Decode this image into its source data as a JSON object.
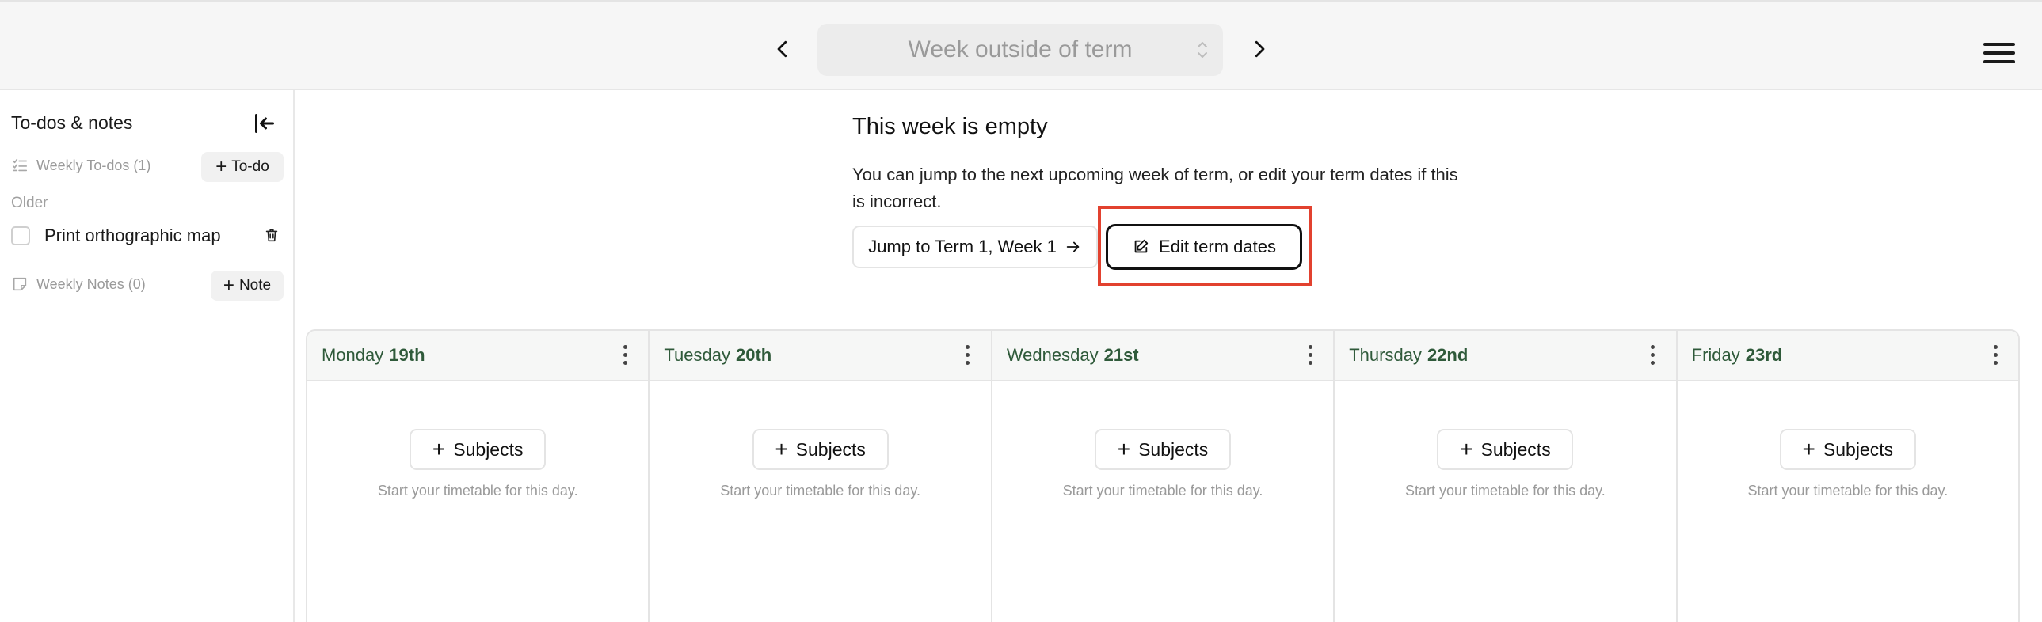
{
  "header": {
    "week_selector": "Week outside of term",
    "prev_icon": "chevron-left-icon",
    "next_icon": "chevron-right-icon",
    "menu_icon": "hamburger-menu-icon"
  },
  "sidebar": {
    "title": "To-dos & notes",
    "todos_label": "Weekly To-dos (1)",
    "add_todo_label": "To-do",
    "older_label": "Older",
    "todo_items": [
      {
        "text": "Print orthographic map",
        "checked": false
      }
    ],
    "notes_label": "Weekly Notes (0)",
    "add_note_label": "Note"
  },
  "notice": {
    "title": "This week is empty",
    "text": "You can jump to the next upcoming week of term, or edit your term dates if this is incorrect.",
    "jump_label": "Jump to Term 1, Week 1",
    "edit_label": "Edit term dates"
  },
  "days": [
    {
      "name": "Monday",
      "date": "19th"
    },
    {
      "name": "Tuesday",
      "date": "20th"
    },
    {
      "name": "Wednesday",
      "date": "21st"
    },
    {
      "name": "Thursday",
      "date": "22nd"
    },
    {
      "name": "Friday",
      "date": "23rd"
    }
  ],
  "day_cell": {
    "add_label": "Subjects",
    "hint": "Start your timetable for this day."
  },
  "colors": {
    "day_header_text": "#2f5a3a",
    "highlight": "#e2412f"
  }
}
